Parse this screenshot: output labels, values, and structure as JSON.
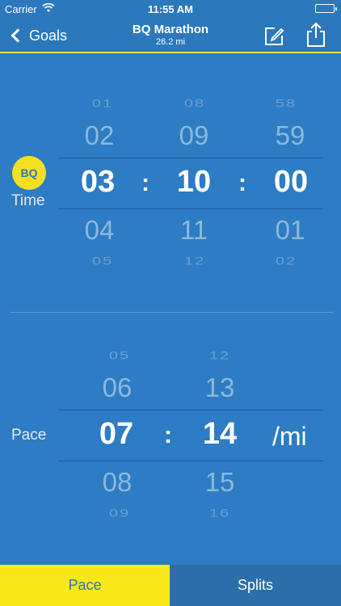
{
  "status": {
    "carrier": "Carrier",
    "time": "11:55 AM"
  },
  "nav": {
    "back_label": "Goals",
    "title": "BQ Marathon",
    "subtitle": "26.2 mi"
  },
  "time_picker": {
    "badge": "BQ",
    "label": "Time",
    "separator": ":",
    "hours": {
      "far_above": "01",
      "above": "02",
      "selected": "03",
      "below": "04",
      "far_below": "05"
    },
    "minutes": {
      "far_above": "08",
      "above": "09",
      "selected": "10",
      "below": "11",
      "far_below": "12"
    },
    "seconds": {
      "far_above": "58",
      "above": "59",
      "selected": "00",
      "below": "01",
      "far_below": "02"
    }
  },
  "pace_picker": {
    "label": "Pace",
    "separator": ":",
    "unit": "/mi",
    "minutes": {
      "far_above": "05",
      "above": "06",
      "selected": "07",
      "below": "08",
      "far_below": "09"
    },
    "seconds": {
      "far_above": "12",
      "above": "13",
      "selected": "14",
      "below": "15",
      "far_below": "16"
    }
  },
  "tabs": {
    "pace": "Pace",
    "splits": "Splits"
  },
  "colors": {
    "background": "#2e7cc3",
    "accent_yellow": "#f8e819",
    "nav_underline": "#d9e24e"
  }
}
